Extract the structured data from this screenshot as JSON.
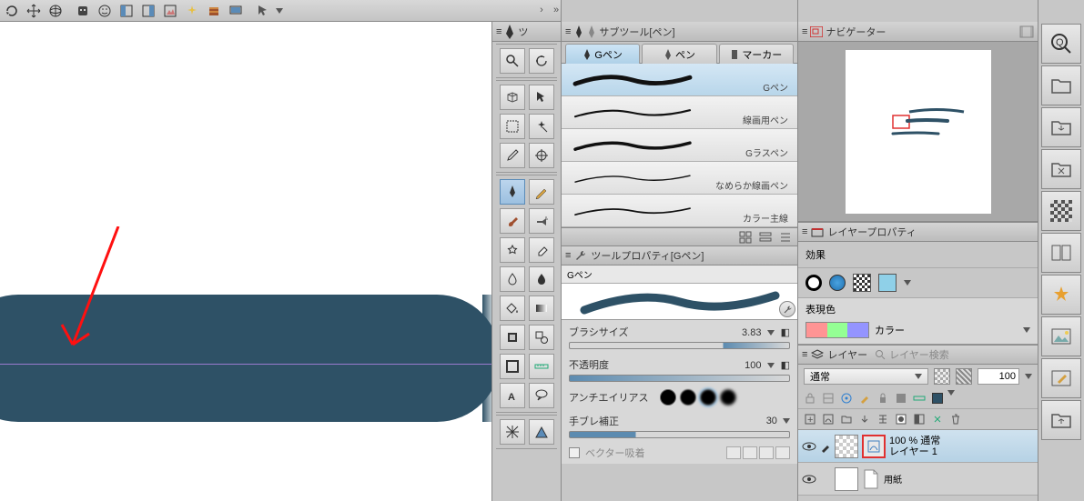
{
  "toolbar": {
    "items": [
      "rotate",
      "move",
      "3d",
      "robot",
      "friend",
      "flip-h",
      "flip-v",
      "effect",
      "sparkle",
      "archive",
      "screen",
      "arrow"
    ]
  },
  "toolsPanel": {
    "title": "ツ"
  },
  "subtool": {
    "header": "サブツール[ペン]",
    "tabs": [
      {
        "label": "Gペン",
        "active": true
      },
      {
        "label": "ペン",
        "active": false
      },
      {
        "label": "マーカー",
        "active": false
      }
    ],
    "brushes": [
      {
        "label": "Gペン",
        "active": true
      },
      {
        "label": "線画用ペン",
        "active": false
      },
      {
        "label": "Gラスペン",
        "active": false
      },
      {
        "label": "なめらか線画ペン",
        "active": false
      },
      {
        "label": "カラー主線",
        "active": false
      }
    ]
  },
  "toolprop": {
    "header": "ツールプロパティ[Gペン]",
    "name": "Gペン",
    "brushSizeLabel": "ブラシサイズ",
    "brushSize": "3.83",
    "opacityLabel": "不透明度",
    "opacity": "100",
    "aaLabel": "アンチエイリアス",
    "stabLabel": "手ブレ補正",
    "stab": "30",
    "vectorLabel": "ベクター吸着"
  },
  "navigator": {
    "header": "ナビゲーター"
  },
  "layerprop": {
    "header": "レイヤープロパティ",
    "effectLabel": "効果",
    "exprLabel": "表現色",
    "colorLabel": "カラー"
  },
  "layer": {
    "header": "レイヤー",
    "searchLabel": "レイヤー検索",
    "blendMode": "通常",
    "opacity": "100",
    "layer1": {
      "pct": "100 % 通常",
      "name": "レイヤー 1"
    },
    "paper": {
      "name": "用紙"
    }
  }
}
